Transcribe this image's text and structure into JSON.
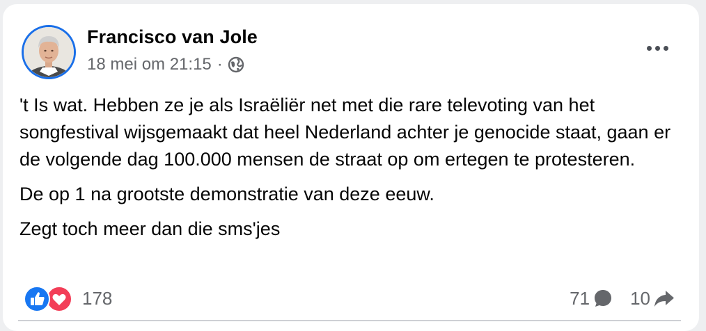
{
  "post": {
    "author": "Francisco van Jole",
    "timestamp": "18 mei om 21:15",
    "separator": "·",
    "audience_icon": "globe-icon",
    "more_icon": "more-options-icon",
    "paragraphs": [
      "'t Is wat. Hebben ze je als Israëliër net met die rare televoting van het songfestival wijsgemaakt dat heel Nederland achter je genocide staat, gaan er de volgende dag 100.000 mensen de straat op om ertegen te protesteren.",
      "De op 1 na grootste demonstratie van deze eeuw.",
      "Zegt toch meer dan die sms'jes"
    ]
  },
  "engagement": {
    "reaction_icons": [
      "like-icon",
      "love-icon"
    ],
    "reaction_count": "178",
    "comment_count": "71",
    "comment_icon": "comment-icon",
    "share_count": "10",
    "share_icon": "share-icon"
  },
  "colors": {
    "like": "#1877f2",
    "love": "#f33e58",
    "avatar_ring": "#1a6fe8",
    "secondary_text": "#65676b"
  }
}
